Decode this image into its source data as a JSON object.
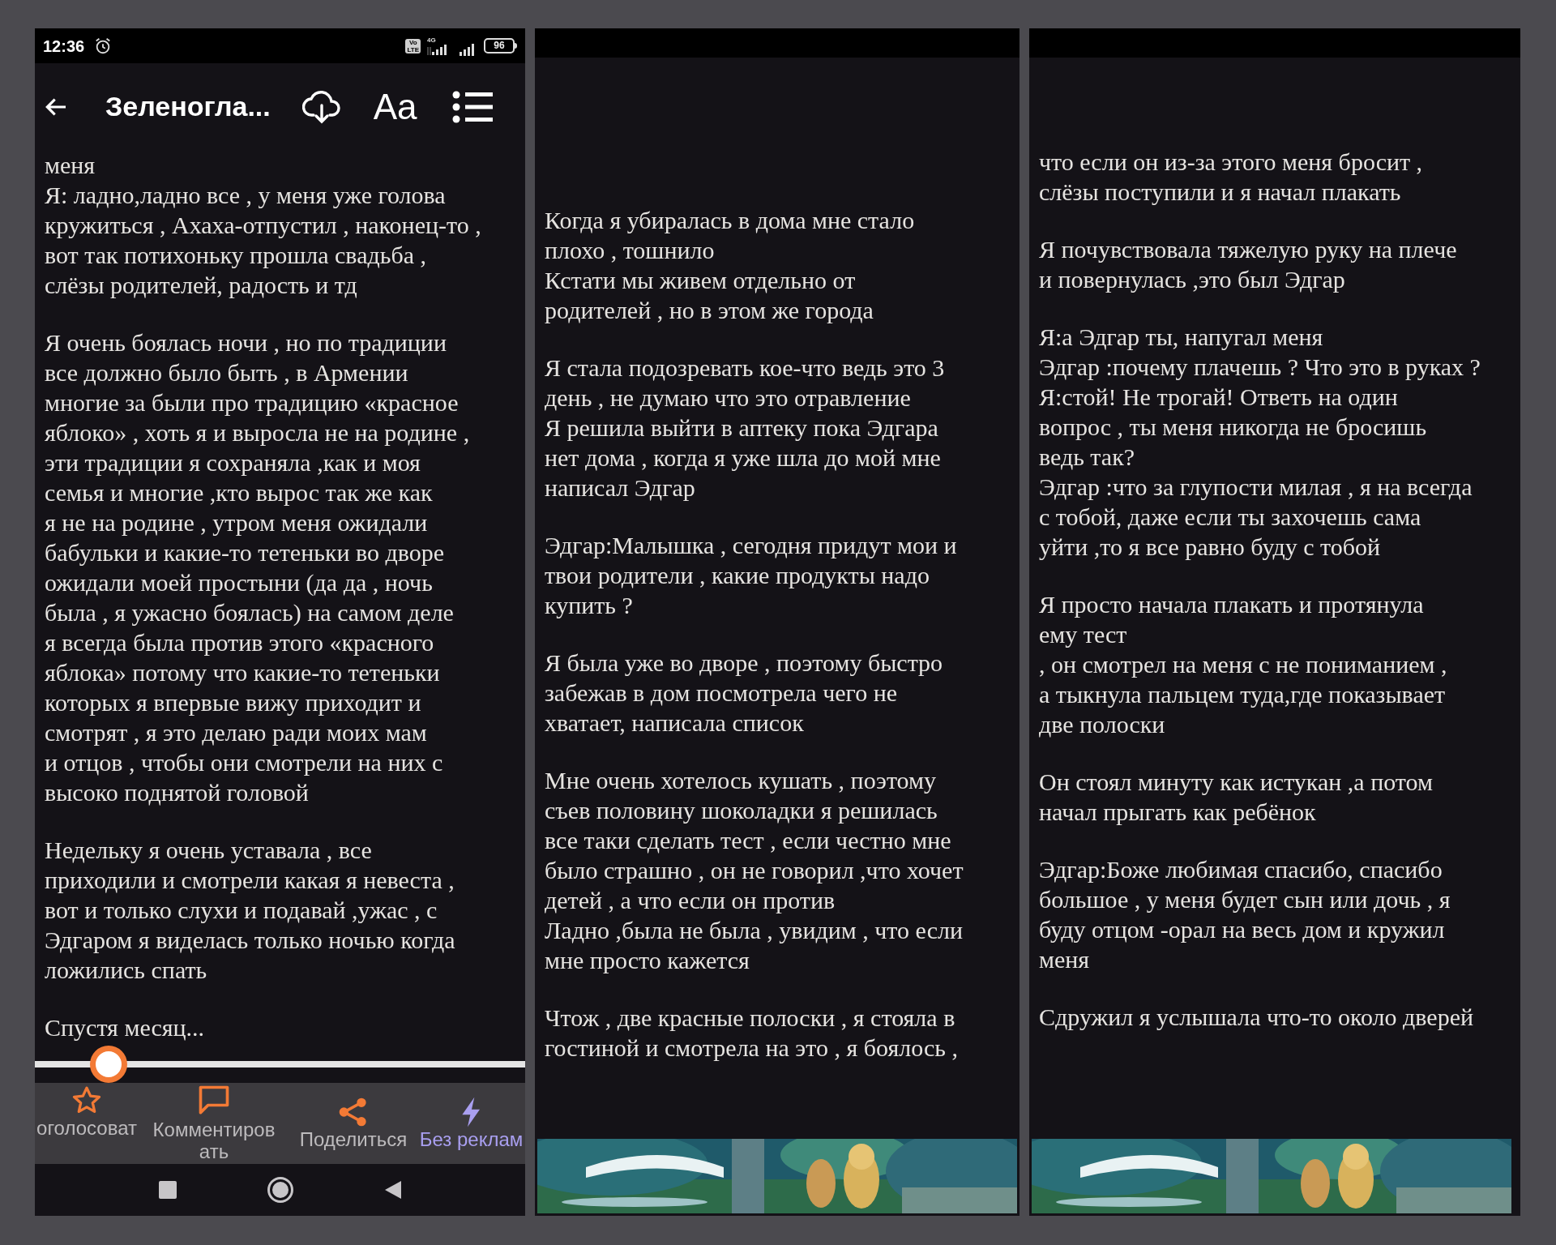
{
  "panels": [
    {
      "kind": "reader",
      "status_bar": {
        "time": "12:36",
        "volte": [
          "Vo",
          "LTE"
        ],
        "network": "4G",
        "battery": "96"
      },
      "toolbar": {
        "title": "Зеленогла...",
        "font_button": "Aa"
      },
      "paragraphs": [
        [
          "меня",
          "Я: ладно,ладно все , у меня уже голова",
          "кружиться , Ахаха-отпустил , наконец-то ,",
          "вот так потихоньку прошла свадьба ,",
          "слёзы родителей, радость и тд"
        ],
        [
          "Я очень боялась ночи , но по традиции",
          "все должно было быть , в Армении",
          "многие за были про традицию «красное",
          "яблоко» , хоть я и выросла не на родине ,",
          "эти традиции я сохраняла ,как и моя",
          "семья и многие ,кто вырос так же как",
          "я не на родине , утром меня ожидали",
          "бабульки и какие-то тетеньки во дворе",
          "ожидали моей простыни (да да , ночь",
          "была , я ужасно боялась) на самом деле",
          "я всегда была против этого «красного",
          "яблока» потому что какие-то тетеньки",
          "которых я впервые вижу приходит и",
          "смотрят , я это делаю ради моих мам",
          "и отцов , чтобы они смотрели на них с",
          "высоко поднятой головой"
        ],
        [
          "Недельку я очень уставала , все",
          "приходили и смотрели какая я невеста ,",
          "вот и только слухи и подавай ,ужас , с",
          "Эдгаром я виделась только ночью когда",
          "ложились спать"
        ],
        [
          "Спустя месяц..."
        ]
      ],
      "progress": {
        "level": 0.15
      },
      "actions": [
        {
          "kind": "vote",
          "label": [
            "оголосоват"
          ],
          "accent": false
        },
        {
          "kind": "comment",
          "label": [
            "Комментиров",
            "ать"
          ],
          "accent": false
        },
        {
          "kind": "share",
          "label": [
            "Поделиться"
          ],
          "accent": false
        },
        {
          "kind": "no_ads",
          "label": [
            "Без реклам"
          ],
          "accent": true
        }
      ]
    },
    {
      "kind": "page",
      "paragraphs": [
        [
          "Когда я убиралась в дома мне стало",
          "плохо , тошнило",
          "Кстати мы живем отдельно от",
          "родителей , но в этом же города"
        ],
        [
          "Я стала подозревать кое-что ведь это 3",
          "день , не думаю что это отравление",
          "Я решила выйти в аптеку пока Эдгара",
          "нет дома , когда я уже шла до мой мне",
          "написал Эдгар"
        ],
        [
          "Эдгар:Малышка , сегодня придут мои и",
          "твои родители , какие продукты надо",
          "купить ?"
        ],
        [
          "Я была уже во дворе , поэтому быстро",
          "забежав в дом посмотрела чего не",
          "хватает, написала список"
        ],
        [
          "Мне очень хотелось кушать , поэтому",
          "съев половину шоколадки я решилась",
          "все таки сделать тест , если честно мне",
          "было страшно , он не говорил ,что хочет",
          "детей , а что если он против",
          "Ладно ,была не была , увидим , что если",
          "мне просто кажется"
        ],
        [
          "Чтож , две красные полоски , я стояла в",
          "гостиной и смотрела на это , я боялось ,"
        ]
      ],
      "ad": {
        "kind": "picture"
      }
    },
    {
      "kind": "page",
      "paragraphs": [
        [
          "что если он из-за этого меня бросит ,",
          "слёзы поступили и я начал плакать"
        ],
        [
          "Я почувствовала тяжелую руку на плече",
          "и повернулась ,это был Эдгар"
        ],
        [
          "Я:а Эдгар ты, напугал меня",
          "Эдгар :почему плачешь ? Что это в руках ?",
          "Я:стой! Не трогай! Ответь на один",
          "вопрос , ты меня никогда не бросишь",
          "ведь так?",
          "Эдгар :что за глупости милая , я на всегда",
          "с тобой, даже если ты захочешь сама",
          "уйти ,то я все равно буду с тобой"
        ],
        [
          "Я просто начала плакать и протянула",
          "ему тест",
          ", он смотрел на меня с не пониманием ,",
          "а тыкнула пальцем туда,где показывает",
          "две полоски"
        ],
        [
          "Он стоял минуту как истукан ,а потом",
          "начал прыгать как ребёнок"
        ],
        [
          "Эдгар:Боже любимая спасибо, спасибо",
          "большое , у меня будет сын или дочь , я",
          "буду отцом -орал на весь дом и кружил",
          "меня"
        ],
        [
          "Сдружил я услышала что-то около дверей"
        ]
      ],
      "ad": {
        "kind": "picture"
      }
    }
  ]
}
